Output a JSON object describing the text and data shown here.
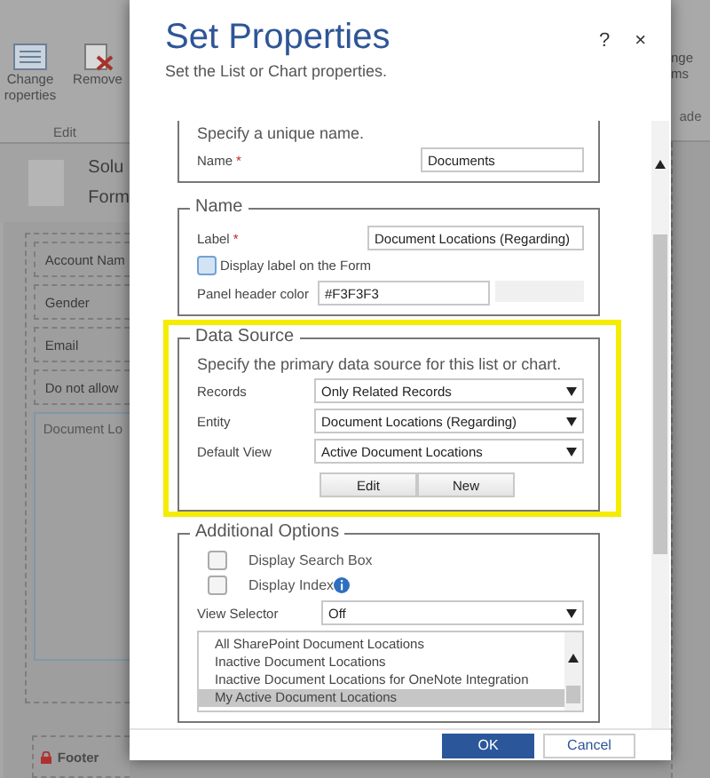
{
  "background": {
    "ribbon": {
      "buttons": [
        {
          "kind": "properties",
          "lines": [
            "Change",
            "roperties"
          ]
        },
        {
          "kind": "remove",
          "lines": [
            "Remove"
          ]
        }
      ],
      "group": "Edit",
      "right_lines": [
        "nge",
        "ms"
      ],
      "right_group": "ade"
    },
    "header": {
      "title": "Solu",
      "subtitle": "Form"
    },
    "fields": [
      "Account Nam",
      "Gender",
      "Email",
      "Do not allow"
    ],
    "subgrid": "Document Lo",
    "footer": "Footer"
  },
  "dialog": {
    "title": "Set Properties",
    "subtitle": "Set the List or Chart properties.",
    "help": "?",
    "close": "×",
    "name_section": {
      "hint": "Specify a unique name.",
      "label": "Name",
      "required_mark": "*",
      "value": "Documents"
    },
    "display_section": {
      "legend": "Name",
      "label": "Label",
      "required_mark": "*",
      "value": "Document Locations (Regarding)",
      "display_label": {
        "text": "Display label on the Form",
        "checked": false
      },
      "color_label": "Panel header color",
      "color_value": "#F3F3F3"
    },
    "data_source": {
      "legend": "Data Source",
      "highlighted": true,
      "hint": "Specify the primary data source for this list or chart.",
      "rows": [
        {
          "label": "Records",
          "value": "Only Related Records"
        },
        {
          "label": "Entity",
          "value": "Document Locations (Regarding)"
        },
        {
          "label": "Default View",
          "value": "Active Document Locations"
        }
      ],
      "buttons": [
        "Edit",
        "New"
      ]
    },
    "additional": {
      "legend": "Additional Options",
      "options": [
        {
          "label": "Display Search Box",
          "checked": false,
          "info": false
        },
        {
          "label": "Display Index",
          "checked": false,
          "info": true
        }
      ],
      "view_selector": {
        "label": "View Selector",
        "value": "Off"
      },
      "views": [
        {
          "label": "All SharePoint Document Locations",
          "selected": false
        },
        {
          "label": "Inactive Document Locations",
          "selected": false
        },
        {
          "label": "Inactive Document Locations for OneNote Integration",
          "selected": false
        },
        {
          "label": "My Active Document Locations",
          "selected": true
        }
      ]
    },
    "buttons": [
      {
        "label": "OK",
        "primary": true
      },
      {
        "label": "Cancel",
        "primary": false
      }
    ]
  }
}
